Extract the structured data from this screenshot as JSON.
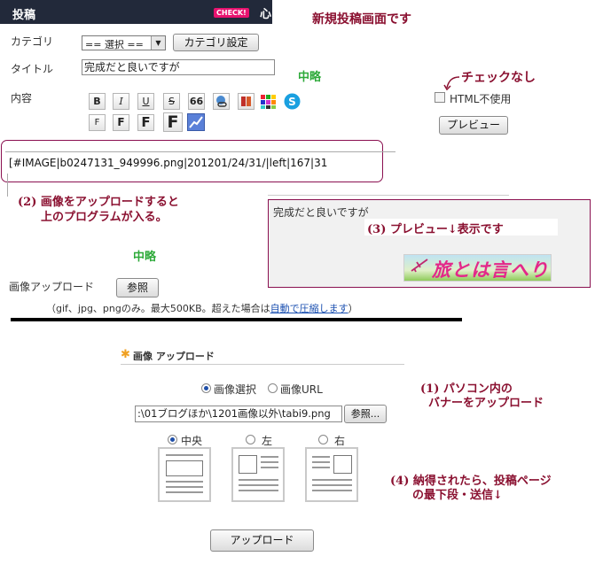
{
  "header": {
    "title": "投稿",
    "check_badge": "CHECK!",
    "truncated_text": "心"
  },
  "notes": {
    "screen_title": "新規投稿画面です",
    "omitted_1": "中略",
    "omitted_2": "中略",
    "no_check": "チェックなし",
    "step2_line1": "(2)  画像をアップロードすると",
    "step2_line2": "上のプログラムが入る。",
    "step3": "(3) プレビュー↓表示です",
    "step1_line1": "(1)  パソコン内の",
    "step1_line2": "バナーをアップロード",
    "step4_line1": "(4)  納得されたら、投稿ページ",
    "step4_line2": "の最下段・送信↓"
  },
  "form": {
    "category_label": "カテゴリ",
    "category_value": "== 選択 ==",
    "category_settings_button": "カテゴリ設定",
    "title_label": "タイトル",
    "title_value": "完成だと良いですが",
    "content_label": "内容",
    "html_checkbox_label": "HTML不使用",
    "preview_button": "プレビュー",
    "code_text": "[#IMAGE|b0247131_949996.png|201201/24/31/|left|167|31"
  },
  "toolbar": {
    "row1": [
      "B",
      "I",
      "U",
      "S",
      "66"
    ],
    "row2": [
      "F",
      "F",
      "F",
      "F"
    ]
  },
  "preview": {
    "text": "完成だと良いですが",
    "banner_text": "旅とは言へり"
  },
  "upload": {
    "label": "画像アップロード",
    "browse_button": "参照",
    "hint_prefix": "（gif、jpg、pngのみ。最大500KB。超えた場合は",
    "hint_link": "自動で圧縮します",
    "hint_suffix": "）"
  },
  "upload_dialog": {
    "title": "画像 アップロード",
    "radio_select": "画像選択",
    "radio_url": "画像URL",
    "file_path": ":\\01ブログほか\\1201画像以外\\tabi9.png",
    "browse_button": "参照...",
    "align_center": "中央",
    "align_left": "左",
    "align_right": "右",
    "upload_button": "アップロード"
  },
  "colors": {
    "header_bg": "#22293a",
    "note_red": "#8a1030",
    "note_green": "#2eaa3a",
    "badge": "#e8136f"
  }
}
